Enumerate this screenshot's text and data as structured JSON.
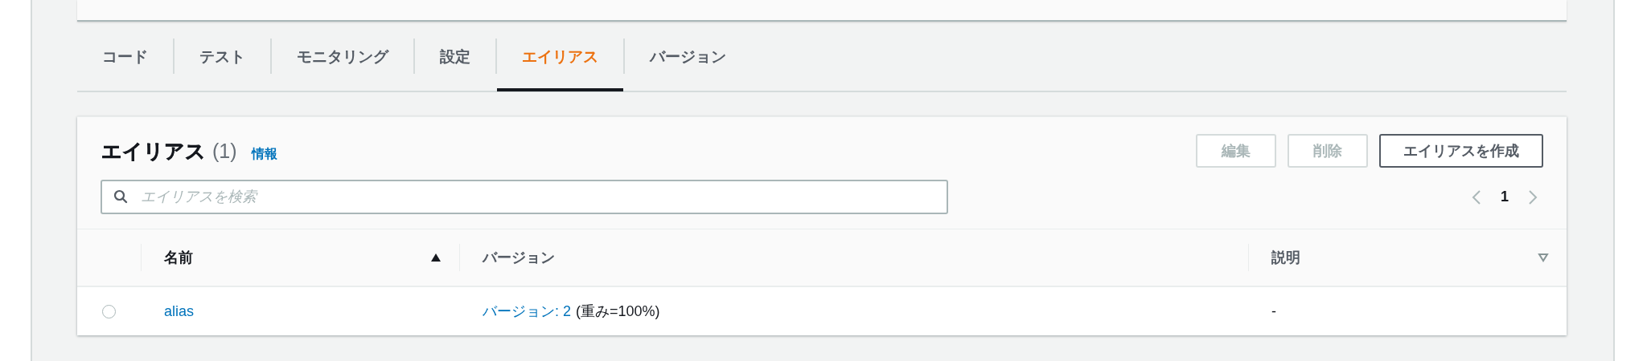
{
  "tabs": [
    {
      "label": "コード",
      "selected": false
    },
    {
      "label": "テスト",
      "selected": false
    },
    {
      "label": "モニタリング",
      "selected": false
    },
    {
      "label": "設定",
      "selected": false
    },
    {
      "label": "エイリアス",
      "selected": true
    },
    {
      "label": "バージョン",
      "selected": false
    }
  ],
  "panel": {
    "title": "エイリアス",
    "count": "(1)",
    "info_link": "情報",
    "buttons": [
      {
        "label": "編集",
        "disabled": true
      },
      {
        "label": "削除",
        "disabled": true
      },
      {
        "label": "エイリアスを作成",
        "disabled": false
      }
    ],
    "search": {
      "placeholder": "エイリアスを検索"
    },
    "pagination": {
      "page": "1"
    },
    "table": {
      "columns": [
        {
          "label": "名前",
          "sorted": true
        },
        {
          "label": "バージョン"
        },
        {
          "label": "説明",
          "sorted": false
        }
      ],
      "rows": [
        {
          "selected": false,
          "name": "alias",
          "version_link": "バージョン: 2",
          "version_note": "(重み=100%)",
          "description": "-"
        }
      ]
    }
  }
}
